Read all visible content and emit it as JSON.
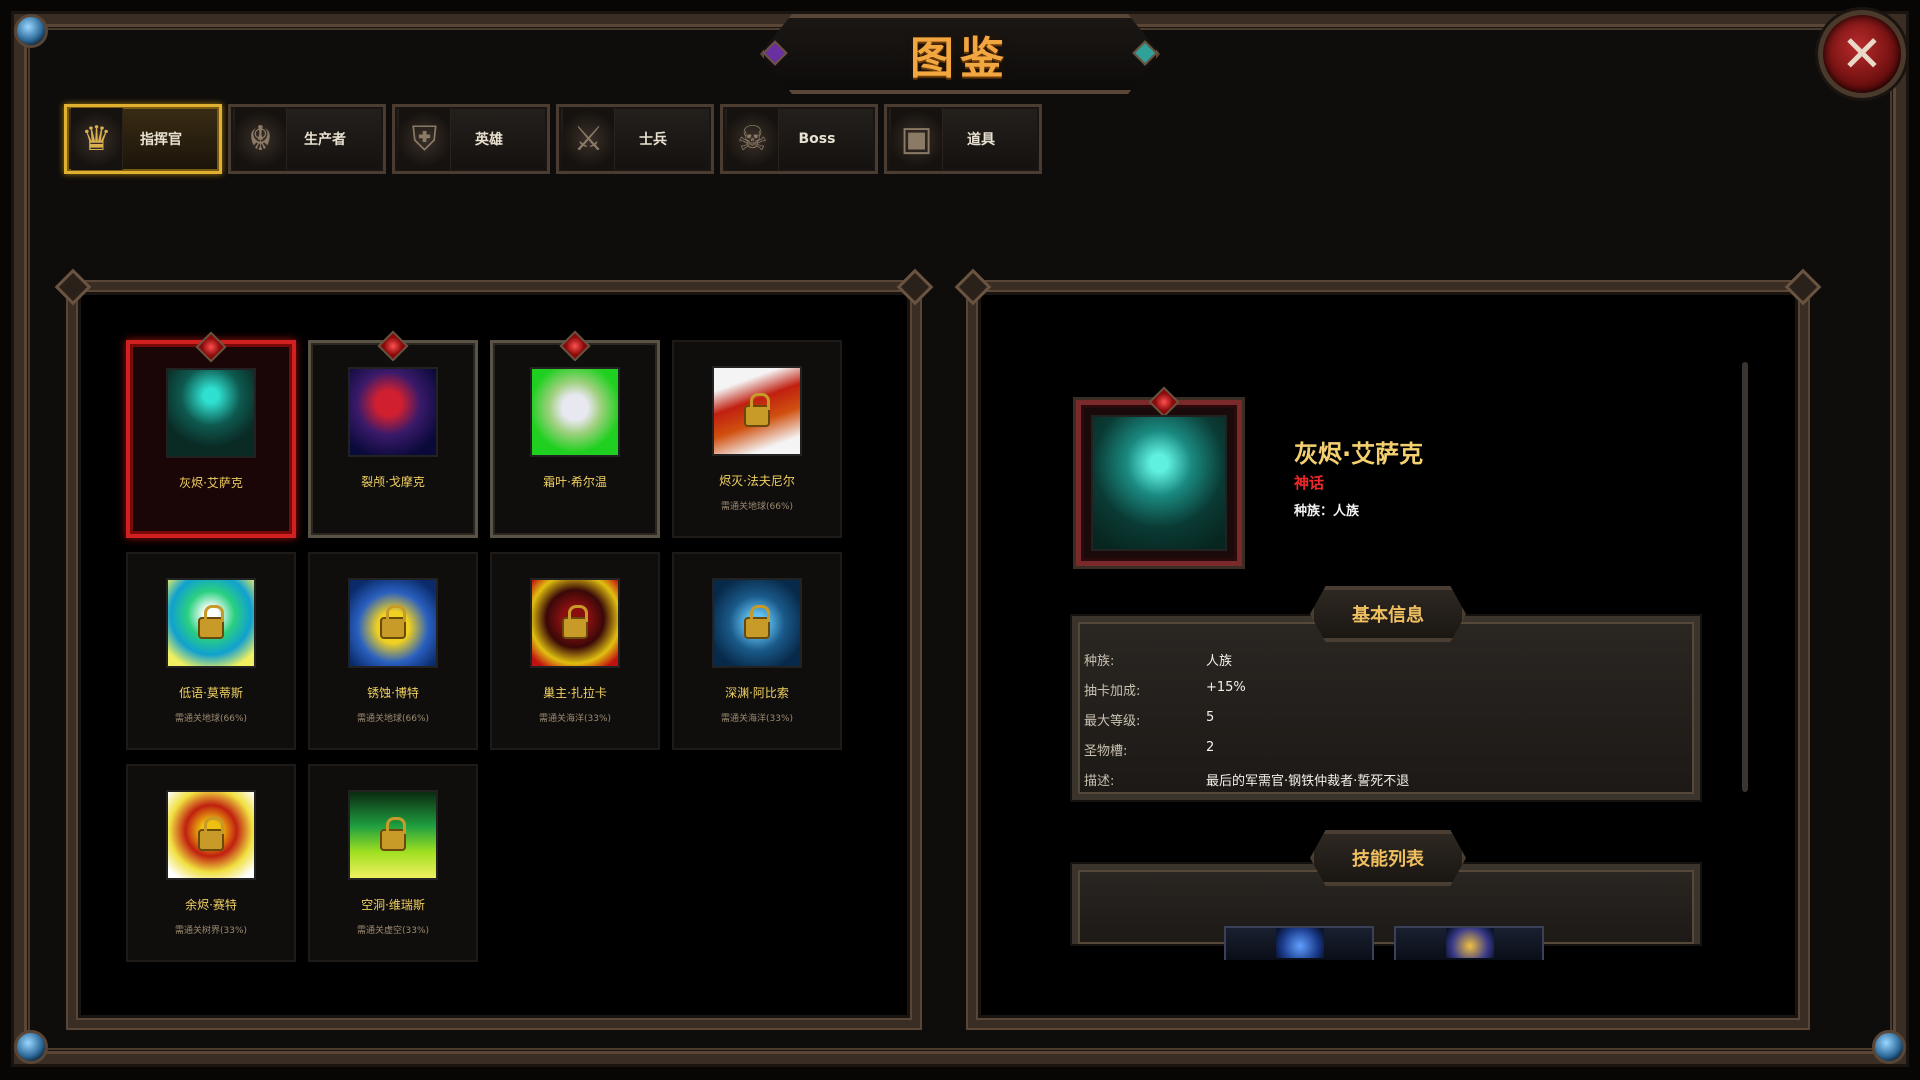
{
  "window": {
    "title": "图鉴",
    "close_label": "✕"
  },
  "tabs": [
    {
      "label": "指挥官",
      "icon": "lion-shield-icon",
      "active": true
    },
    {
      "label": "生产者",
      "icon": "dragon-head-icon",
      "active": false
    },
    {
      "label": "英雄",
      "icon": "knight-helmet-icon",
      "active": false
    },
    {
      "label": "士兵",
      "icon": "crossed-swords-icon",
      "active": false
    },
    {
      "label": "Boss",
      "icon": "demon-icon",
      "active": false
    },
    {
      "label": "道具",
      "icon": "treasure-chest-icon",
      "active": false
    }
  ],
  "cards": [
    {
      "name": "灰烬·艾萨克",
      "requirement": "",
      "owned": true,
      "selected": true,
      "locked": false
    },
    {
      "name": "裂颅·戈摩克",
      "requirement": "",
      "owned": true,
      "selected": false,
      "locked": false
    },
    {
      "name": "霜叶·希尔温",
      "requirement": "",
      "owned": true,
      "selected": false,
      "locked": false
    },
    {
      "name": "烬灭·法夫尼尔",
      "requirement": "需通关地球(66%)",
      "owned": false,
      "selected": false,
      "locked": true
    },
    {
      "name": "低语·莫蒂斯",
      "requirement": "需通关地球(66%)",
      "owned": false,
      "selected": false,
      "locked": true
    },
    {
      "name": "锈蚀·博特",
      "requirement": "需通关地球(66%)",
      "owned": false,
      "selected": false,
      "locked": true
    },
    {
      "name": "巢主·扎拉卡",
      "requirement": "需通关海洋(33%)",
      "owned": false,
      "selected": false,
      "locked": true
    },
    {
      "name": "深渊·阿比索",
      "requirement": "需通关海洋(33%)",
      "owned": false,
      "selected": false,
      "locked": true
    },
    {
      "name": "余烬·赛特",
      "requirement": "需通关树界(33%)",
      "owned": false,
      "selected": false,
      "locked": true
    },
    {
      "name": "空洞·维瑞斯",
      "requirement": "需通关虚空(33%)",
      "owned": false,
      "selected": false,
      "locked": true
    }
  ],
  "detail": {
    "name": "灰烬·艾萨克",
    "rarity": "神话",
    "race_line": "种族：人族",
    "basic_info_title": "基本信息",
    "basic_info": [
      {
        "key": "种族:",
        "value": "人族"
      },
      {
        "key": "抽卡加成:",
        "value": "+15%"
      },
      {
        "key": "最大等级:",
        "value": "5"
      },
      {
        "key": "圣物槽:",
        "value": "2"
      },
      {
        "key": "描述:",
        "value": "最后的军需官·钢铁仲裁者·誓死不退"
      }
    ],
    "skills_title": "技能列表"
  },
  "colors": {
    "title_gold": "#f2a640",
    "rarity_mythic": "#f02828",
    "card_name": "#f0d060",
    "active_tab_border": "#e0b030",
    "selected_card_border": "#d02020"
  }
}
